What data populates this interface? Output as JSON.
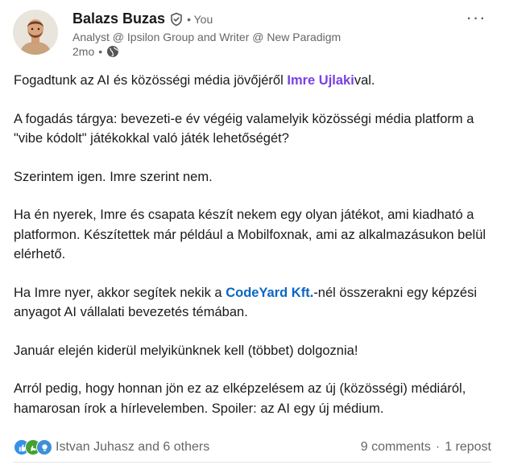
{
  "author": {
    "name": "Balazs Buzas",
    "you_label": "• You",
    "headline": "Analyst @ Ipsilon Group and Writer @ New Paradigm",
    "time": "2mo",
    "visibility_icon": "globe-icon",
    "verified_icon": "verified-shield-icon"
  },
  "menu": {
    "more_label": "···"
  },
  "post": {
    "p1": {
      "before": "Fogadtunk az AI és közösségi média jövőjéről ",
      "mention": "Imre Ujlaki",
      "after": "val."
    },
    "p2": "A fogadás tárgya: bevezeti-e év végéig valamelyik közösségi média platform a \"vibe kódolt\" játékokkal való játék lehetőségét?",
    "p3": "Szerintem igen. Imre szerint nem.",
    "p4": "Ha én nyerek, Imre és csapata készít nekem egy olyan játékot, ami kiadható a platformon. Készítettek már például a Mobilfoxnak, ami az alkalmazásukon belül elérhető.",
    "p5": {
      "before": "Ha Imre nyer, akkor segítek nekik a ",
      "mention": "CodeYard Kft.",
      "after": "-nél összerakni egy képzési anyagot AI vállalati bevezetés témában."
    },
    "p6": "Január elején kiderül melyikünknek kell (többet) dolgoznia!",
    "p7": "Arról pedig, hogy honnan jön ez az elképzelésem az új (közösségi) médiáról, hamarosan írok a hírlevelemben. Spoiler: az AI egy új médium."
  },
  "social": {
    "reactions_text": "Istvan Juhasz and 6 others",
    "comments": "9 comments",
    "separator": "·",
    "reposts": "1 repost",
    "reaction_icons": [
      "like-icon",
      "celebrate-icon",
      "insightful-icon"
    ]
  },
  "colors": {
    "person_mention": "#7a3fe4",
    "company_mention": "#0a66c2",
    "secondary_text": "#666666",
    "like": "#378fe9",
    "celebrate": "#44a12f"
  }
}
